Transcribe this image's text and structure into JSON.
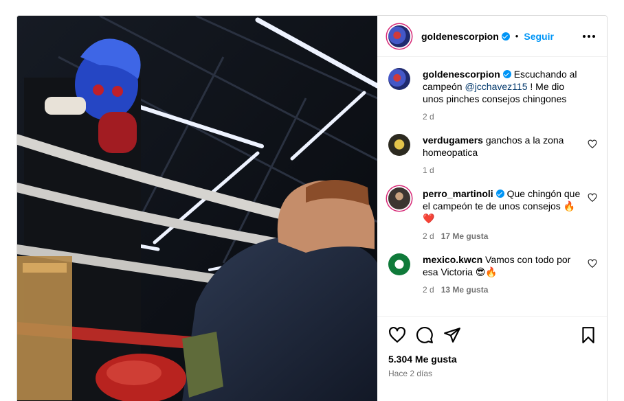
{
  "post": {
    "author": "goldenescorpion",
    "follow_label": "Seguir",
    "separator": "•",
    "caption": {
      "user": "goldenescorpion",
      "text_before": "Escuchando al campeón ",
      "mention": "@jcchavez115",
      "text_after": " ! Me dio unos pinches consejos chingones",
      "time": "2 d"
    },
    "comments": [
      {
        "user": "verdugamers",
        "verified": false,
        "text": "ganchos a la zona homeopatica",
        "time": "1 d",
        "likes": ""
      },
      {
        "user": "perro_martinoli",
        "verified": true,
        "text": "Que chingón que el campeón te de unos consejos 🔥❤️",
        "time": "2 d",
        "likes": "17 Me gusta"
      },
      {
        "user": "mexico.kwcn",
        "verified": false,
        "text": "Vamos con todo por esa Victoria 😎🔥",
        "time": "2 d",
        "likes": "13 Me gusta"
      }
    ],
    "likes_count": "5.304 Me gusta",
    "posted_ago": "Hace 2 días"
  },
  "colors": {
    "accent": "#0095f6",
    "verified": "#0095f6",
    "mention": "#00376b",
    "secondary_text": "#737373",
    "border": "#dbdbdb"
  },
  "icons": {
    "more": "more-options-icon",
    "like": "heart-icon",
    "comment": "comment-icon",
    "share": "share-icon",
    "save": "bookmark-icon"
  }
}
